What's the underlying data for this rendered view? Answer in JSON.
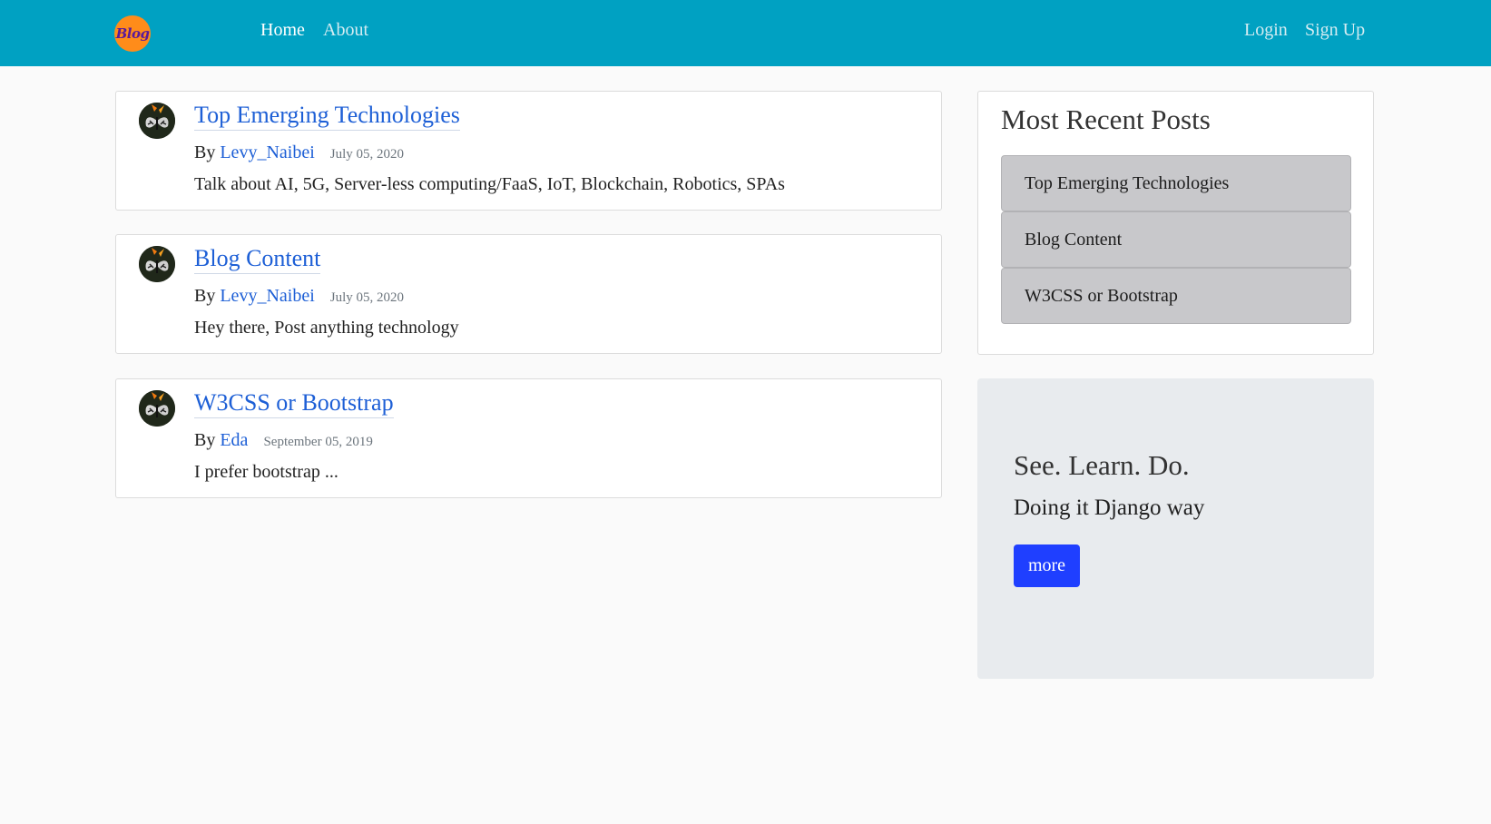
{
  "nav": {
    "logo_text": "Blog",
    "links": [
      {
        "label": "Home",
        "active": true
      },
      {
        "label": "About",
        "active": false
      }
    ],
    "login_label": "Login",
    "signup_label": "Sign Up"
  },
  "posts": [
    {
      "title": "Top Emerging Technologies",
      "by_label": "By",
      "author": "Levy_Naibei",
      "date": "July 05, 2020",
      "excerpt": "Talk about AI, 5G, Server-less computing/FaaS, IoT, Blockchain, Robotics, SPAs"
    },
    {
      "title": "Blog Content",
      "by_label": "By",
      "author": "Levy_Naibei",
      "date": "July 05, 2020",
      "excerpt": "Hey there, Post anything technology"
    },
    {
      "title": "W3CSS or Bootstrap",
      "by_label": "By",
      "author": "Eda",
      "date": "September 05, 2019",
      "excerpt": "I prefer bootstrap ..."
    }
  ],
  "sidebar": {
    "title": "Most Recent Posts",
    "items": [
      {
        "label": "Top Emerging Technologies"
      },
      {
        "label": "Blog Content"
      },
      {
        "label": "W3CSS or Bootstrap"
      }
    ]
  },
  "jumbotron": {
    "title": "See. Learn. Do.",
    "subtitle": "Doing it Django way",
    "button_label": "more"
  },
  "colors": {
    "navbar": "#00a1c2",
    "link": "#1d5fd6",
    "button": "#1f3fff",
    "logo_bg": "#ff8c1a"
  }
}
